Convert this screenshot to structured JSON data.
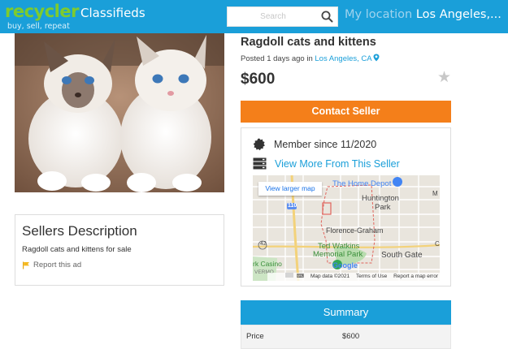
{
  "header": {
    "logo_main": "recycler",
    "logo_sub": "Classifieds",
    "tagline": "buy, sell, repeat",
    "search_placeholder": "Search",
    "location_label": "My location",
    "location_value": "Los Angeles,..."
  },
  "listing": {
    "title": "Ragdoll cats and kittens",
    "posted_prefix": "Posted 1 days ago in",
    "posted_location": "Los Angeles, CA",
    "price": "$600",
    "contact_label": "Contact Seller"
  },
  "seller_box": {
    "member_since": "Member since 11/2020",
    "view_more": "View More From This Seller"
  },
  "map": {
    "larger_map": "View larger map",
    "labels": {
      "home_depot": "The Home Depot",
      "huntington": "Huntington",
      "park": "Park",
      "florence": "Florence-Graham",
      "ted1": "Ted Watkins",
      "ted2": "Memorial Park",
      "south_gate": "South Gate",
      "park_casino": "rk Casino",
      "vermont": "VERMO",
      "route": "110",
      "route2": "42",
      "edge_m": "M",
      "edge_c": "C",
      "google": "Google"
    },
    "attribution": {
      "data": "Map data ©2021",
      "terms": "Terms of Use",
      "report": "Report a map error"
    }
  },
  "description": {
    "heading": "Sellers Description",
    "text": "Ragdoll cats and kittens for sale",
    "report": "Report this ad"
  },
  "summary": {
    "heading": "Summary",
    "rows": [
      {
        "key": "Price",
        "value": "$600"
      }
    ]
  },
  "colors": {
    "header_blue": "#1a9fd9",
    "logo_green": "#7ecb2e",
    "contact_orange": "#f47f1a",
    "link_blue": "#1a9fd9"
  }
}
